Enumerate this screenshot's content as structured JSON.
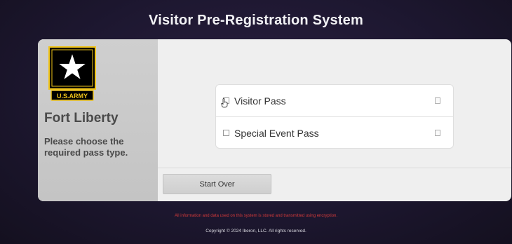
{
  "header": {
    "title": "Visitor Pre-Registration System"
  },
  "sidebar": {
    "logo_text": "U.S.ARMY",
    "fort_name": "Fort Liberty",
    "instruction": "Please choose the required pass type."
  },
  "pass_types": [
    {
      "label": "Visitor Pass",
      "icon": "checkbox-icon"
    },
    {
      "label": "Special Event Pass",
      "icon": "checkbox-icon"
    }
  ],
  "actions": {
    "start_over_label": "Start Over"
  },
  "footer": {
    "notice": "All information and data used on this system is stored and transmitted using encryption.",
    "copyright": "Copyright © 2024 Iberon, LLC. All rights reserved."
  },
  "colors": {
    "background": "#1d1730",
    "card": "#efefef",
    "sidebar": "#c8c8c8",
    "logo_gold": "#f0c419",
    "notice_red": "#d23a3a"
  }
}
